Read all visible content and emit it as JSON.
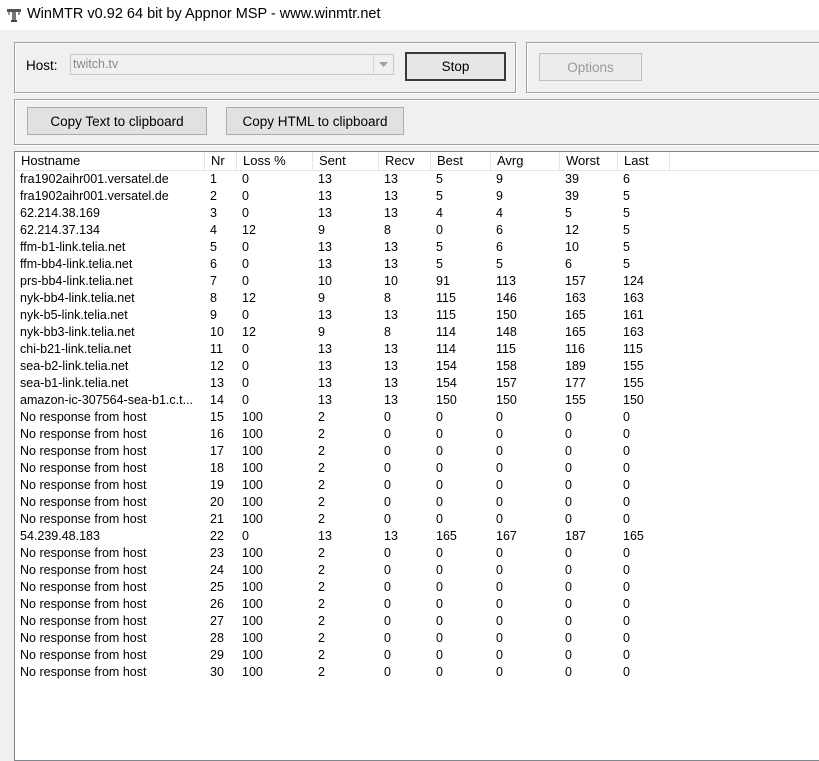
{
  "window": {
    "title": "WinMTR v0.92 64 bit by Appnor MSP - www.winmtr.net",
    "app_icon": "winmtr-icon"
  },
  "host": {
    "label": "Host:",
    "value": "twitch.tv",
    "dropdown_icon": "chevron-down-icon"
  },
  "buttons": {
    "stop": "Stop",
    "options": "Options",
    "copy_text": "Copy Text to clipboard",
    "copy_html": "Copy HTML to clipboard"
  },
  "table": {
    "columns": [
      "Hostname",
      "Nr",
      "Loss %",
      "Sent",
      "Recv",
      "Best",
      "Avrg",
      "Worst",
      "Last"
    ],
    "rows": [
      [
        "fra1902aihr001.versatel.de",
        "1",
        "0",
        "13",
        "13",
        "5",
        "9",
        "39",
        "6"
      ],
      [
        "fra1902aihr001.versatel.de",
        "2",
        "0",
        "13",
        "13",
        "5",
        "9",
        "39",
        "5"
      ],
      [
        "62.214.38.169",
        "3",
        "0",
        "13",
        "13",
        "4",
        "4",
        "5",
        "5"
      ],
      [
        "62.214.37.134",
        "4",
        "12",
        "9",
        "8",
        "0",
        "6",
        "12",
        "5"
      ],
      [
        "ffm-b1-link.telia.net",
        "5",
        "0",
        "13",
        "13",
        "5",
        "6",
        "10",
        "5"
      ],
      [
        "ffm-bb4-link.telia.net",
        "6",
        "0",
        "13",
        "13",
        "5",
        "5",
        "6",
        "5"
      ],
      [
        "prs-bb4-link.telia.net",
        "7",
        "0",
        "10",
        "10",
        "91",
        "113",
        "157",
        "124"
      ],
      [
        "nyk-bb4-link.telia.net",
        "8",
        "12",
        "9",
        "8",
        "115",
        "146",
        "163",
        "163"
      ],
      [
        "nyk-b5-link.telia.net",
        "9",
        "0",
        "13",
        "13",
        "115",
        "150",
        "165",
        "161"
      ],
      [
        "nyk-bb3-link.telia.net",
        "10",
        "12",
        "9",
        "8",
        "114",
        "148",
        "165",
        "163"
      ],
      [
        "chi-b21-link.telia.net",
        "11",
        "0",
        "13",
        "13",
        "114",
        "115",
        "116",
        "115"
      ],
      [
        "sea-b2-link.telia.net",
        "12",
        "0",
        "13",
        "13",
        "154",
        "158",
        "189",
        "155"
      ],
      [
        "sea-b1-link.telia.net",
        "13",
        "0",
        "13",
        "13",
        "154",
        "157",
        "177",
        "155"
      ],
      [
        "amazon-ic-307564-sea-b1.c.t...",
        "14",
        "0",
        "13",
        "13",
        "150",
        "150",
        "155",
        "150"
      ],
      [
        "No response from host",
        "15",
        "100",
        "2",
        "0",
        "0",
        "0",
        "0",
        "0"
      ],
      [
        "No response from host",
        "16",
        "100",
        "2",
        "0",
        "0",
        "0",
        "0",
        "0"
      ],
      [
        "No response from host",
        "17",
        "100",
        "2",
        "0",
        "0",
        "0",
        "0",
        "0"
      ],
      [
        "No response from host",
        "18",
        "100",
        "2",
        "0",
        "0",
        "0",
        "0",
        "0"
      ],
      [
        "No response from host",
        "19",
        "100",
        "2",
        "0",
        "0",
        "0",
        "0",
        "0"
      ],
      [
        "No response from host",
        "20",
        "100",
        "2",
        "0",
        "0",
        "0",
        "0",
        "0"
      ],
      [
        "No response from host",
        "21",
        "100",
        "2",
        "0",
        "0",
        "0",
        "0",
        "0"
      ],
      [
        "54.239.48.183",
        "22",
        "0",
        "13",
        "13",
        "165",
        "167",
        "187",
        "165"
      ],
      [
        "No response from host",
        "23",
        "100",
        "2",
        "0",
        "0",
        "0",
        "0",
        "0"
      ],
      [
        "No response from host",
        "24",
        "100",
        "2",
        "0",
        "0",
        "0",
        "0",
        "0"
      ],
      [
        "No response from host",
        "25",
        "100",
        "2",
        "0",
        "0",
        "0",
        "0",
        "0"
      ],
      [
        "No response from host",
        "26",
        "100",
        "2",
        "0",
        "0",
        "0",
        "0",
        "0"
      ],
      [
        "No response from host",
        "27",
        "100",
        "2",
        "0",
        "0",
        "0",
        "0",
        "0"
      ],
      [
        "No response from host",
        "28",
        "100",
        "2",
        "0",
        "0",
        "0",
        "0",
        "0"
      ],
      [
        "No response from host",
        "29",
        "100",
        "2",
        "0",
        "0",
        "0",
        "0",
        "0"
      ],
      [
        "No response from host",
        "30",
        "100",
        "2",
        "0",
        "0",
        "0",
        "0",
        "0"
      ]
    ]
  }
}
